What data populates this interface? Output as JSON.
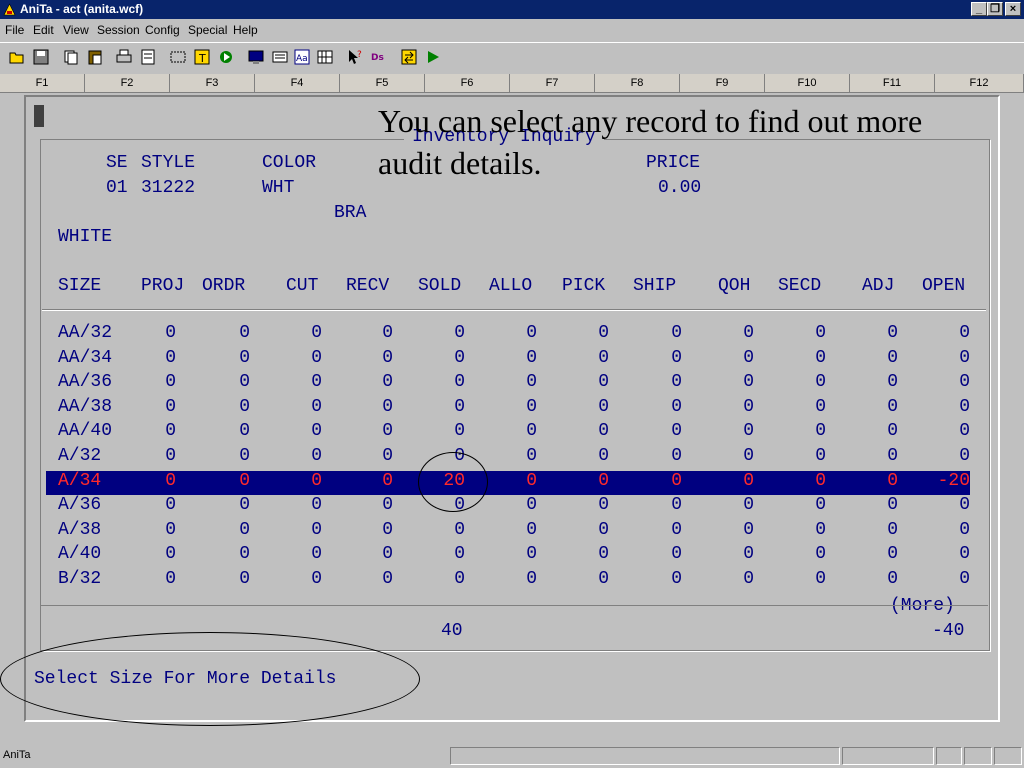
{
  "window": {
    "title": "AniTa - act (anita.wcf)",
    "controls": {
      "minimize": "_",
      "restore": "❐",
      "close": "×"
    }
  },
  "menu": [
    "File",
    "Edit",
    "View",
    "Session",
    "Config",
    "Special",
    "Help"
  ],
  "toolbar_icons": [
    "open-icon",
    "save-icon",
    "copy-icon",
    "paste-icon",
    "print-icon",
    "print-setup-icon",
    "capture-icon",
    "text-icon",
    "run-icon",
    "terminal-icon",
    "keyboard-icon",
    "font-icon",
    "grid-icon",
    "help-icon",
    "dos-icon",
    "transfer-icon",
    "play-icon"
  ],
  "fkeys": [
    "F1",
    "F2",
    "F3",
    "F4",
    "F5",
    "F6",
    "F7",
    "F8",
    "F9",
    "F10",
    "F11",
    "F12"
  ],
  "screen": {
    "title": "Inventory Inquiry",
    "header": {
      "se_label": "SE",
      "style_label": "STYLE",
      "color_label": "COLOR",
      "price_label": "PRICE",
      "se": "01",
      "style": "31222",
      "color": "WHT",
      "price": "0.00",
      "bra": "BRA",
      "color_desc": "WHITE"
    },
    "columns": [
      "SIZE",
      "PROJ",
      "ORDR",
      "CUT",
      "RECV",
      "SOLD",
      "ALLO",
      "PICK",
      "SHIP",
      "QOH",
      "SECD",
      "ADJ",
      "OPEN"
    ],
    "rows": [
      [
        "AA/32",
        "0",
        "0",
        "0",
        "0",
        "0",
        "0",
        "0",
        "0",
        "0",
        "0",
        "0",
        "0"
      ],
      [
        "AA/34",
        "0",
        "0",
        "0",
        "0",
        "0",
        "0",
        "0",
        "0",
        "0",
        "0",
        "0",
        "0"
      ],
      [
        "AA/36",
        "0",
        "0",
        "0",
        "0",
        "0",
        "0",
        "0",
        "0",
        "0",
        "0",
        "0",
        "0"
      ],
      [
        "AA/38",
        "0",
        "0",
        "0",
        "0",
        "0",
        "0",
        "0",
        "0",
        "0",
        "0",
        "0",
        "0"
      ],
      [
        "AA/40",
        "0",
        "0",
        "0",
        "0",
        "0",
        "0",
        "0",
        "0",
        "0",
        "0",
        "0",
        "0"
      ],
      [
        "A/32",
        "0",
        "0",
        "0",
        "0",
        "0",
        "0",
        "0",
        "0",
        "0",
        "0",
        "0",
        "0"
      ],
      [
        "A/34",
        "0",
        "0",
        "0",
        "0",
        "20",
        "0",
        "0",
        "0",
        "0",
        "0",
        "0",
        "-20"
      ],
      [
        "A/36",
        "0",
        "0",
        "0",
        "0",
        "0",
        "0",
        "0",
        "0",
        "0",
        "0",
        "0",
        "0"
      ],
      [
        "A/38",
        "0",
        "0",
        "0",
        "0",
        "0",
        "0",
        "0",
        "0",
        "0",
        "0",
        "0",
        "0"
      ],
      [
        "A/40",
        "0",
        "0",
        "0",
        "0",
        "0",
        "0",
        "0",
        "0",
        "0",
        "0",
        "0",
        "0"
      ],
      [
        "B/32",
        "0",
        "0",
        "0",
        "0",
        "0",
        "0",
        "0",
        "0",
        "0",
        "0",
        "0",
        "0"
      ]
    ],
    "selected_row": 6,
    "more": "(More)",
    "totals": {
      "sold": "40",
      "open": "-40"
    },
    "prompt": "Select Size For More Details"
  },
  "annotation": "You can select any record to find out more audit details.",
  "status": {
    "app": "AniTa"
  }
}
